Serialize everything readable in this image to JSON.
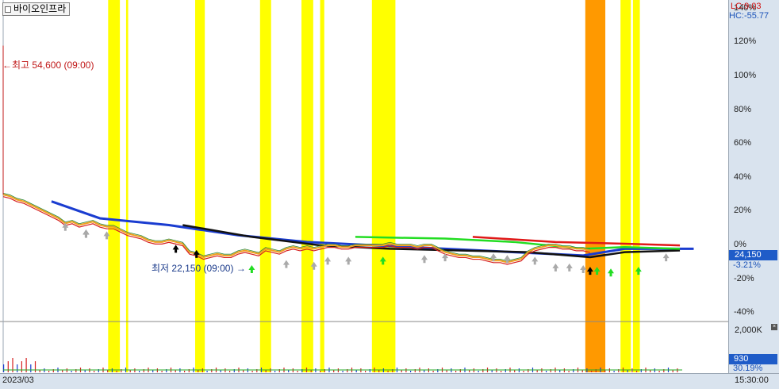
{
  "stock": {
    "name": "바이오인프라"
  },
  "indicators": {
    "lc": "LC:9.03",
    "hc": "HC:-55.77"
  },
  "current": {
    "price": "24,150",
    "pct": "-3.21%"
  },
  "volume": {
    "scale_label": "2,000K",
    "value": "930",
    "pct": "30.19%"
  },
  "annotations": {
    "high": "최고 54,600 (09:00)",
    "low": "최저 22,150 (09:00)"
  },
  "footer": {
    "date": "2023/03",
    "time": "15:30:00"
  },
  "colors": {
    "ma_blue": "#1a3cd0",
    "ma_black": "#111111",
    "ma_green": "#22dd22",
    "ma_red": "#e01818",
    "highlight_yellow": "#ffff00",
    "highlight_orange": "#ff9900",
    "price_red": "#d62020"
  },
  "chart_data": {
    "type": "line",
    "y_axis_unit": "%",
    "yticks": [
      "140%",
      "120%",
      "100%",
      "80%",
      "60%",
      "40%",
      "20%",
      "0%",
      "-20%",
      "-40%"
    ],
    "ylim": [
      -45,
      145
    ],
    "price_series": [
      [
        0,
        30
      ],
      [
        1,
        29
      ],
      [
        2,
        27
      ],
      [
        3,
        26
      ],
      [
        4,
        24
      ],
      [
        5,
        22
      ],
      [
        6,
        20
      ],
      [
        7,
        18
      ],
      [
        8,
        16
      ],
      [
        9,
        13
      ],
      [
        10,
        14
      ],
      [
        11,
        12
      ],
      [
        12,
        13
      ],
      [
        13,
        14
      ],
      [
        14,
        12
      ],
      [
        15,
        11
      ],
      [
        16,
        11
      ],
      [
        17,
        9
      ],
      [
        18,
        7
      ],
      [
        19,
        6
      ],
      [
        20,
        5
      ],
      [
        21,
        3
      ],
      [
        22,
        2
      ],
      [
        23,
        2
      ],
      [
        24,
        3
      ],
      [
        25,
        2
      ],
      [
        26,
        1
      ],
      [
        27,
        -4
      ],
      [
        28,
        -5
      ],
      [
        29,
        -7
      ],
      [
        30,
        -6
      ],
      [
        31,
        -5
      ],
      [
        32,
        -6
      ],
      [
        33,
        -6
      ],
      [
        34,
        -4
      ],
      [
        35,
        -3
      ],
      [
        36,
        -4
      ],
      [
        37,
        -5
      ],
      [
        38,
        -2
      ],
      [
        39,
        -3
      ],
      [
        40,
        -4
      ],
      [
        41,
        -2
      ],
      [
        42,
        -1
      ],
      [
        43,
        -2
      ],
      [
        44,
        -1
      ],
      [
        45,
        -2
      ],
      [
        46,
        -1
      ],
      [
        47,
        0
      ],
      [
        48,
        0
      ],
      [
        49,
        -1
      ],
      [
        50,
        -1
      ],
      [
        51,
        0
      ],
      [
        52,
        0
      ],
      [
        53,
        0
      ],
      [
        54,
        0
      ],
      [
        55,
        0
      ],
      [
        56,
        1
      ],
      [
        57,
        0
      ],
      [
        58,
        0
      ],
      [
        59,
        0
      ],
      [
        60,
        -1
      ],
      [
        61,
        0
      ],
      [
        62,
        0
      ],
      [
        63,
        -2
      ],
      [
        64,
        -4
      ],
      [
        65,
        -5
      ],
      [
        66,
        -6
      ],
      [
        67,
        -6
      ],
      [
        68,
        -7
      ],
      [
        69,
        -7
      ],
      [
        70,
        -8
      ],
      [
        71,
        -9
      ],
      [
        72,
        -9
      ],
      [
        73,
        -10
      ],
      [
        74,
        -9
      ],
      [
        75,
        -8
      ],
      [
        76,
        -4
      ],
      [
        77,
        -2
      ],
      [
        78,
        -1
      ],
      [
        79,
        0
      ],
      [
        80,
        0
      ],
      [
        81,
        -1
      ],
      [
        82,
        -1
      ],
      [
        83,
        -2
      ],
      [
        84,
        -2
      ],
      [
        85,
        -3
      ]
    ],
    "highlight_bands": [
      {
        "from": 15.2,
        "to": 16.9,
        "color": "yellow"
      },
      {
        "from": 17.8,
        "to": 18.1,
        "color": "yellow"
      },
      {
        "from": 27.8,
        "to": 29.2,
        "color": "yellow"
      },
      {
        "from": 37.2,
        "to": 38.8,
        "color": "yellow"
      },
      {
        "from": 43.2,
        "to": 44.9,
        "color": "yellow"
      },
      {
        "from": 45.9,
        "to": 46.5,
        "color": "yellow"
      },
      {
        "from": 53.4,
        "to": 56.8,
        "color": "yellow"
      },
      {
        "from": 84.3,
        "to": 87.2,
        "color": "orange"
      },
      {
        "from": 89.4,
        "to": 90.9,
        "color": "yellow"
      },
      {
        "from": 91.2,
        "to": 92.2,
        "color": "yellow"
      }
    ],
    "ma_lines": [
      {
        "color": "blue",
        "points": [
          [
            7,
            26
          ],
          [
            14,
            16
          ],
          [
            24,
            12
          ],
          [
            34,
            6
          ],
          [
            44,
            2
          ],
          [
            54,
            0
          ],
          [
            64,
            -2
          ],
          [
            74,
            -4
          ],
          [
            84,
            -6
          ],
          [
            90,
            -2
          ],
          [
            100,
            -2
          ]
        ]
      },
      {
        "color": "black",
        "points": [
          [
            26,
            12
          ],
          [
            36,
            5
          ],
          [
            46,
            0
          ],
          [
            56,
            -2
          ],
          [
            66,
            -3
          ],
          [
            76,
            -4
          ],
          [
            85,
            -7
          ],
          [
            90,
            -4
          ],
          [
            98,
            -3
          ]
        ]
      },
      {
        "color": "green",
        "points": [
          [
            51,
            5
          ],
          [
            64,
            4
          ],
          [
            74,
            2
          ],
          [
            84,
            -2
          ],
          [
            90,
            -1
          ],
          [
            98,
            -2
          ]
        ]
      },
      {
        "color": "red",
        "points": [
          [
            68,
            5
          ],
          [
            80,
            2
          ],
          [
            90,
            1
          ],
          [
            98,
            0
          ]
        ]
      }
    ],
    "x_span": 105,
    "low_point_index": 36,
    "high_label_y": 118
  }
}
